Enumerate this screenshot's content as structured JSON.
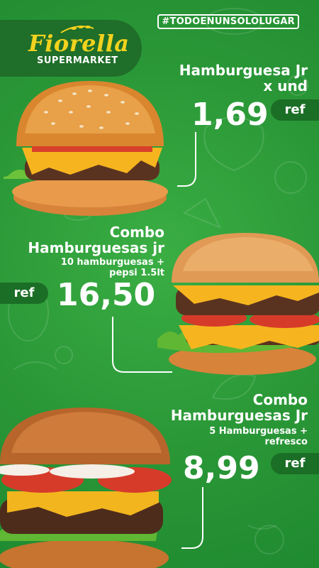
{
  "hashtag": "#TODOENUNSOLOLUGAR",
  "brand": {
    "name": "Fiorella",
    "tagline": "SUPERMARKET"
  },
  "colors": {
    "background": "#2e9a3a",
    "panel": "#1b6e26",
    "brand_yellow": "#f2d21e"
  },
  "offers": [
    {
      "title_line1": "Hamburguesa Jr",
      "title_line2": "x und",
      "price": "1,69",
      "ref_label": "ref"
    },
    {
      "title_line1": "Combo",
      "title_line2": "Hamburguesas jr",
      "detail_line1": "10 hamburguesas +",
      "detail_line2": "pepsi 1.5lt",
      "price": "16,50",
      "ref_label": "ref"
    },
    {
      "title_line1": "Combo",
      "title_line2": "Hamburguesas Jr",
      "detail_line1": "5 Hamburguesas +",
      "detail_line2": "refresco",
      "price": "8,99",
      "ref_label": "ref"
    }
  ]
}
